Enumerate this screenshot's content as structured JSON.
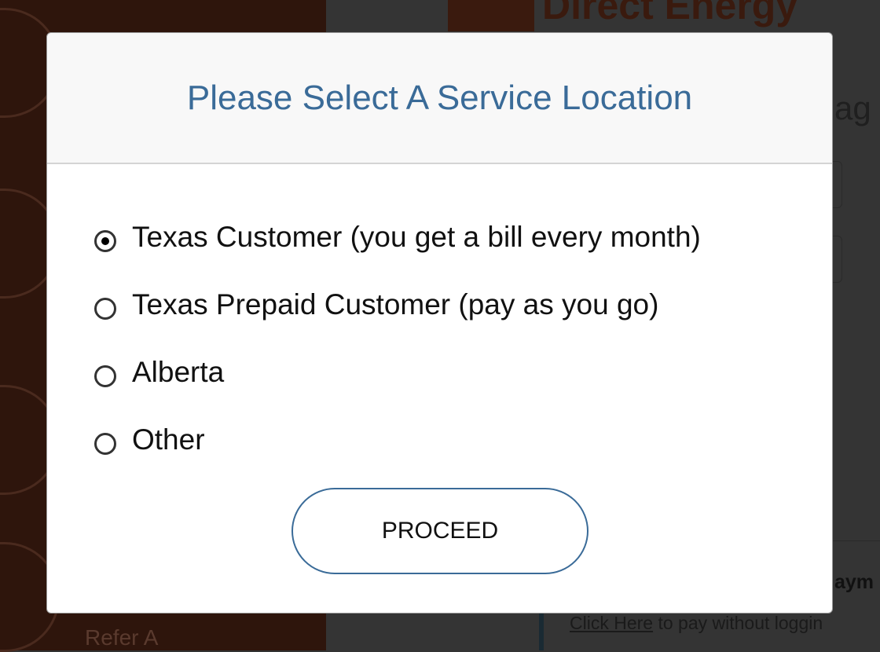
{
  "background": {
    "brand": "Direct Energy",
    "heading_fragment": "ag",
    "payment_fragment": "aym",
    "click_here": "Click Here",
    "click_rest": " to pay without loggin",
    "sidebar_fragment": "Refer A"
  },
  "modal": {
    "title": "Please Select A Service Location",
    "options": [
      {
        "label": "Texas Customer (you get a bill every month)",
        "selected": true
      },
      {
        "label": "Texas Prepaid Customer (pay as you go)",
        "selected": false
      },
      {
        "label": "Alberta",
        "selected": false
      },
      {
        "label": "Other",
        "selected": false
      }
    ],
    "proceed_label": "PROCEED"
  },
  "colors": {
    "accent": "#3a6b98",
    "sidebar": "#2e150c",
    "overlay": "#343434"
  }
}
